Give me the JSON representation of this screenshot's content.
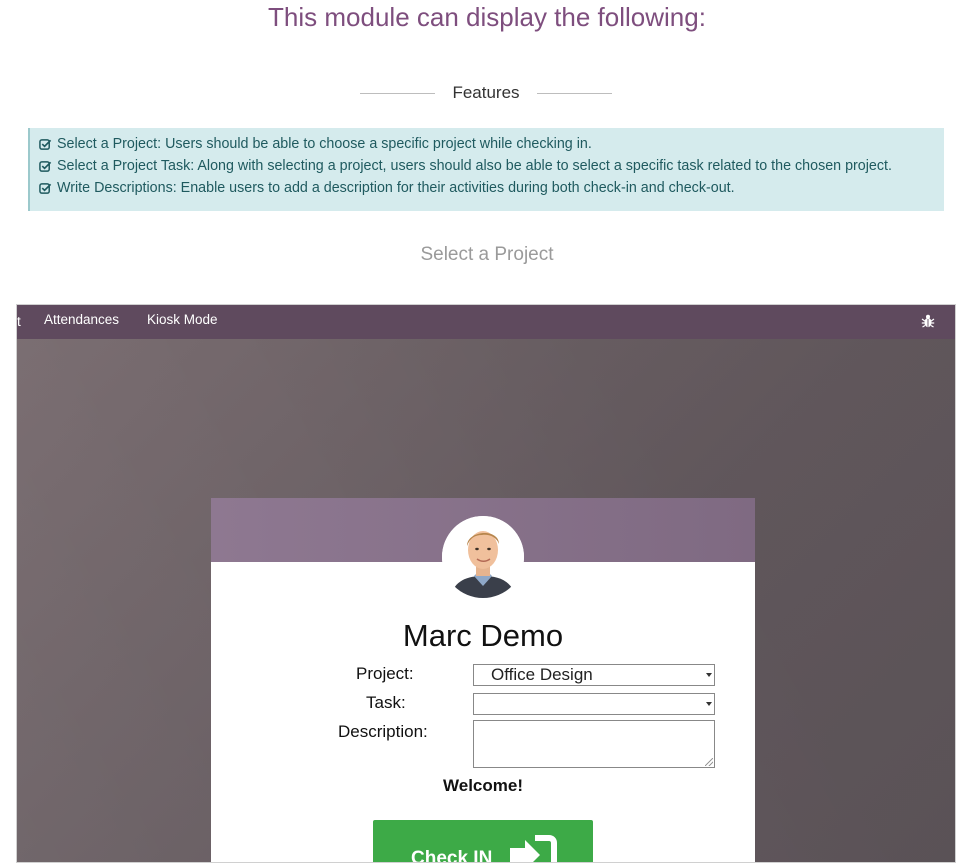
{
  "page": {
    "heading": "This module can display the following:",
    "features_label": "Features",
    "features": [
      "Select a Project: Users should be able to choose a specific project while checking in.",
      "Select a Project Task: Along with selecting a project, users should also be able to select a specific task related to the chosen project.",
      "Write Descriptions: Enable users to add a description for their activities during both check-in and check-out."
    ],
    "subheading": "Select a Project"
  },
  "app": {
    "navbar": {
      "cut_item": "t",
      "items": [
        "Attendances",
        "Kiosk Mode"
      ],
      "debug_icon": "bug-icon"
    },
    "card": {
      "employee_name": "Marc Demo",
      "project_label": "Project:",
      "project_value": "Office Design",
      "task_label": "Task:",
      "task_value": "",
      "description_label": "Description:",
      "description_value": "",
      "welcome": "Welcome!",
      "checkin_label": "Check IN",
      "checkin_icon": "sign-in-icon"
    }
  },
  "colors": {
    "heading": "#7e4e7e",
    "navbar": "#5f4a5e",
    "feature_box_bg": "#d5ebed",
    "feature_text": "#1f5a5f",
    "checkin_button": "#3daa47",
    "card_header": "#8e7891"
  }
}
